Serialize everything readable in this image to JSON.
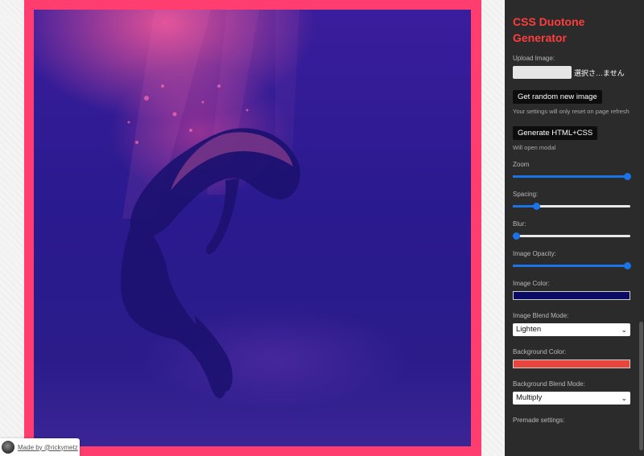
{
  "panel": {
    "title": "CSS Duotone Generator",
    "upload": {
      "label": "Upload Image:",
      "file_status": "選択さ…ません"
    },
    "random_button": "Get random new image",
    "random_note": "Your settings will only reset on page refresh",
    "generate_button": "Generate HTML+CSS",
    "generate_note": "Will open modal",
    "zoom": {
      "label": "Zoom",
      "level": 1.0
    },
    "spacing": {
      "label": "Spacing:",
      "level": 0.2
    },
    "blur": {
      "label": "Blur:",
      "level": 0.0
    },
    "image_opacity": {
      "label": "Image Opacity:",
      "level": 1.0
    },
    "image_color": {
      "label": "Image Color:",
      "value": "#0c0b63"
    },
    "image_blend": {
      "label": "Image Blend Mode:",
      "selected": "Lighten"
    },
    "background_color": {
      "label": "Background Color:",
      "value": "#e8453c"
    },
    "background_blend": {
      "label": "Background Blend Mode:",
      "selected": "Multiply"
    },
    "premade": {
      "label": "Premade settings:"
    }
  },
  "credit": {
    "text": "Made by @rickymetz"
  },
  "colors": {
    "frame": "#ff3d6e",
    "accent_title": "#ff3d3d",
    "slider": "#1a73e8",
    "panel_bg": "#2b2b2b"
  },
  "icons": {
    "avatar": "avatar",
    "chevron": "chevron-down-icon"
  }
}
